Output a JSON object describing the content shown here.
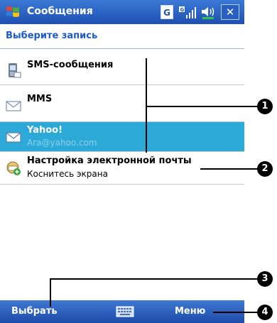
{
  "titlebar": {
    "title": "Сообщения",
    "status_icons": [
      "windows-start-icon",
      "gprs-icon",
      "signal-icon",
      "volume-icon",
      "close-icon"
    ],
    "g_label": "G",
    "close_label": "✕"
  },
  "header": {
    "title": "Выберите запись"
  },
  "list": {
    "items": [
      {
        "label": "SMS-сообщения",
        "sub": "",
        "icon": "sms-icon"
      },
      {
        "label": "MMS",
        "sub": "",
        "icon": "mail-icon"
      },
      {
        "label": "Yahoo!",
        "sub": "Ara@yahoo.com",
        "icon": "mail-icon",
        "selected": true
      },
      {
        "label": "Настройка электронной почты",
        "sub": "Коснитесь экрана",
        "icon": "setup-icon"
      }
    ]
  },
  "callouts": [
    "1",
    "2",
    "3",
    "4"
  ],
  "softkeys": {
    "left": "Выбрать",
    "right": "Меню"
  },
  "colors": {
    "titlebar": "#1f4fb0",
    "selection": "#2ca9d7",
    "header_text": "#1e5bc6"
  }
}
